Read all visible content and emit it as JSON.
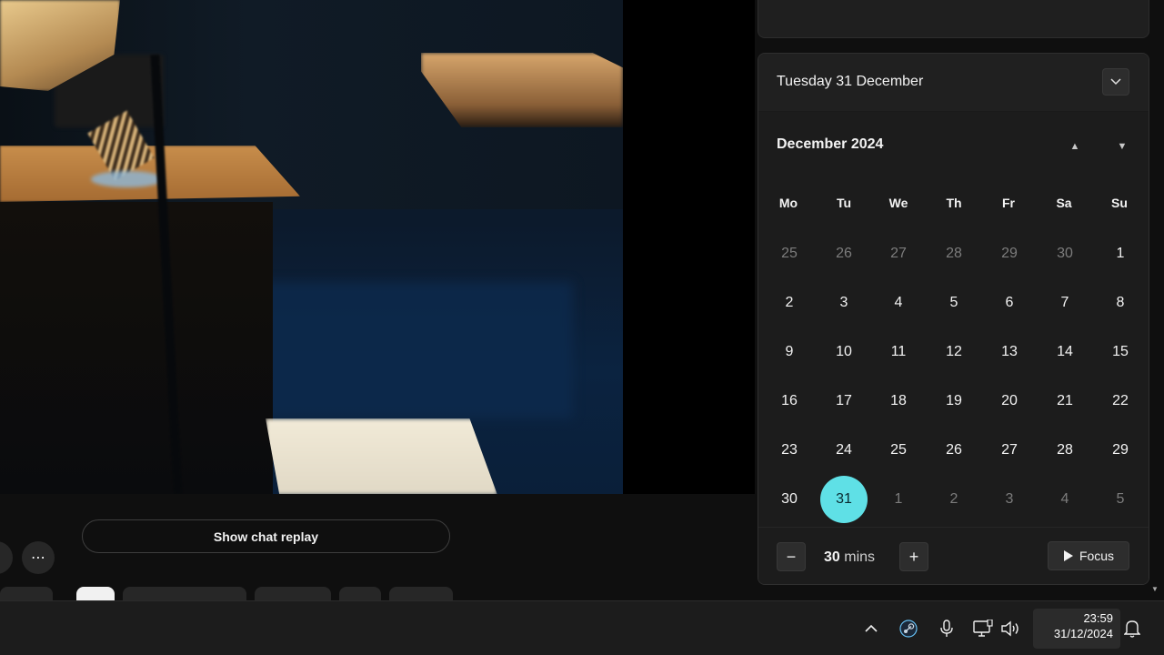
{
  "video": {
    "chat_replay_label": "Show chat replay",
    "more_label": "⋯"
  },
  "calendar": {
    "selected_date_label": "Tuesday 31 December",
    "month_label": "December 2024",
    "weekdays": [
      "Mo",
      "Tu",
      "We",
      "Th",
      "Fr",
      "Sa",
      "Su"
    ],
    "weeks": [
      [
        {
          "d": "25",
          "o": true
        },
        {
          "d": "26",
          "o": true
        },
        {
          "d": "27",
          "o": true
        },
        {
          "d": "28",
          "o": true
        },
        {
          "d": "29",
          "o": true
        },
        {
          "d": "30",
          "o": true
        },
        {
          "d": "1",
          "o": false
        }
      ],
      [
        {
          "d": "2",
          "o": false
        },
        {
          "d": "3",
          "o": false
        },
        {
          "d": "4",
          "o": false
        },
        {
          "d": "5",
          "o": false
        },
        {
          "d": "6",
          "o": false
        },
        {
          "d": "7",
          "o": false
        },
        {
          "d": "8",
          "o": false
        }
      ],
      [
        {
          "d": "9",
          "o": false
        },
        {
          "d": "10",
          "o": false
        },
        {
          "d": "11",
          "o": false
        },
        {
          "d": "12",
          "o": false
        },
        {
          "d": "13",
          "o": false
        },
        {
          "d": "14",
          "o": false
        },
        {
          "d": "15",
          "o": false
        }
      ],
      [
        {
          "d": "16",
          "o": false
        },
        {
          "d": "17",
          "o": false
        },
        {
          "d": "18",
          "o": false
        },
        {
          "d": "19",
          "o": false
        },
        {
          "d": "20",
          "o": false
        },
        {
          "d": "21",
          "o": false
        },
        {
          "d": "22",
          "o": false
        }
      ],
      [
        {
          "d": "23",
          "o": false
        },
        {
          "d": "24",
          "o": false
        },
        {
          "d": "25",
          "o": false
        },
        {
          "d": "26",
          "o": false
        },
        {
          "d": "27",
          "o": false
        },
        {
          "d": "28",
          "o": false
        },
        {
          "d": "29",
          "o": false
        }
      ],
      [
        {
          "d": "30",
          "o": false
        },
        {
          "d": "31",
          "o": false,
          "today": true
        },
        {
          "d": "1",
          "o": true
        },
        {
          "d": "2",
          "o": true
        },
        {
          "d": "3",
          "o": true
        },
        {
          "d": "4",
          "o": true
        },
        {
          "d": "5",
          "o": true
        }
      ]
    ],
    "focus": {
      "minutes_value": "30",
      "minutes_unit": "mins",
      "decrease_label": "−",
      "increase_label": "+",
      "focus_label": "Focus"
    },
    "today_color": "#5fe0e6"
  },
  "taskbar": {
    "time": "23:59",
    "date": "31/12/2024",
    "tray_icons": [
      "chevron-up-icon",
      "steam-icon",
      "microphone-icon",
      "network-icon",
      "volume-icon",
      "bell-icon"
    ]
  }
}
